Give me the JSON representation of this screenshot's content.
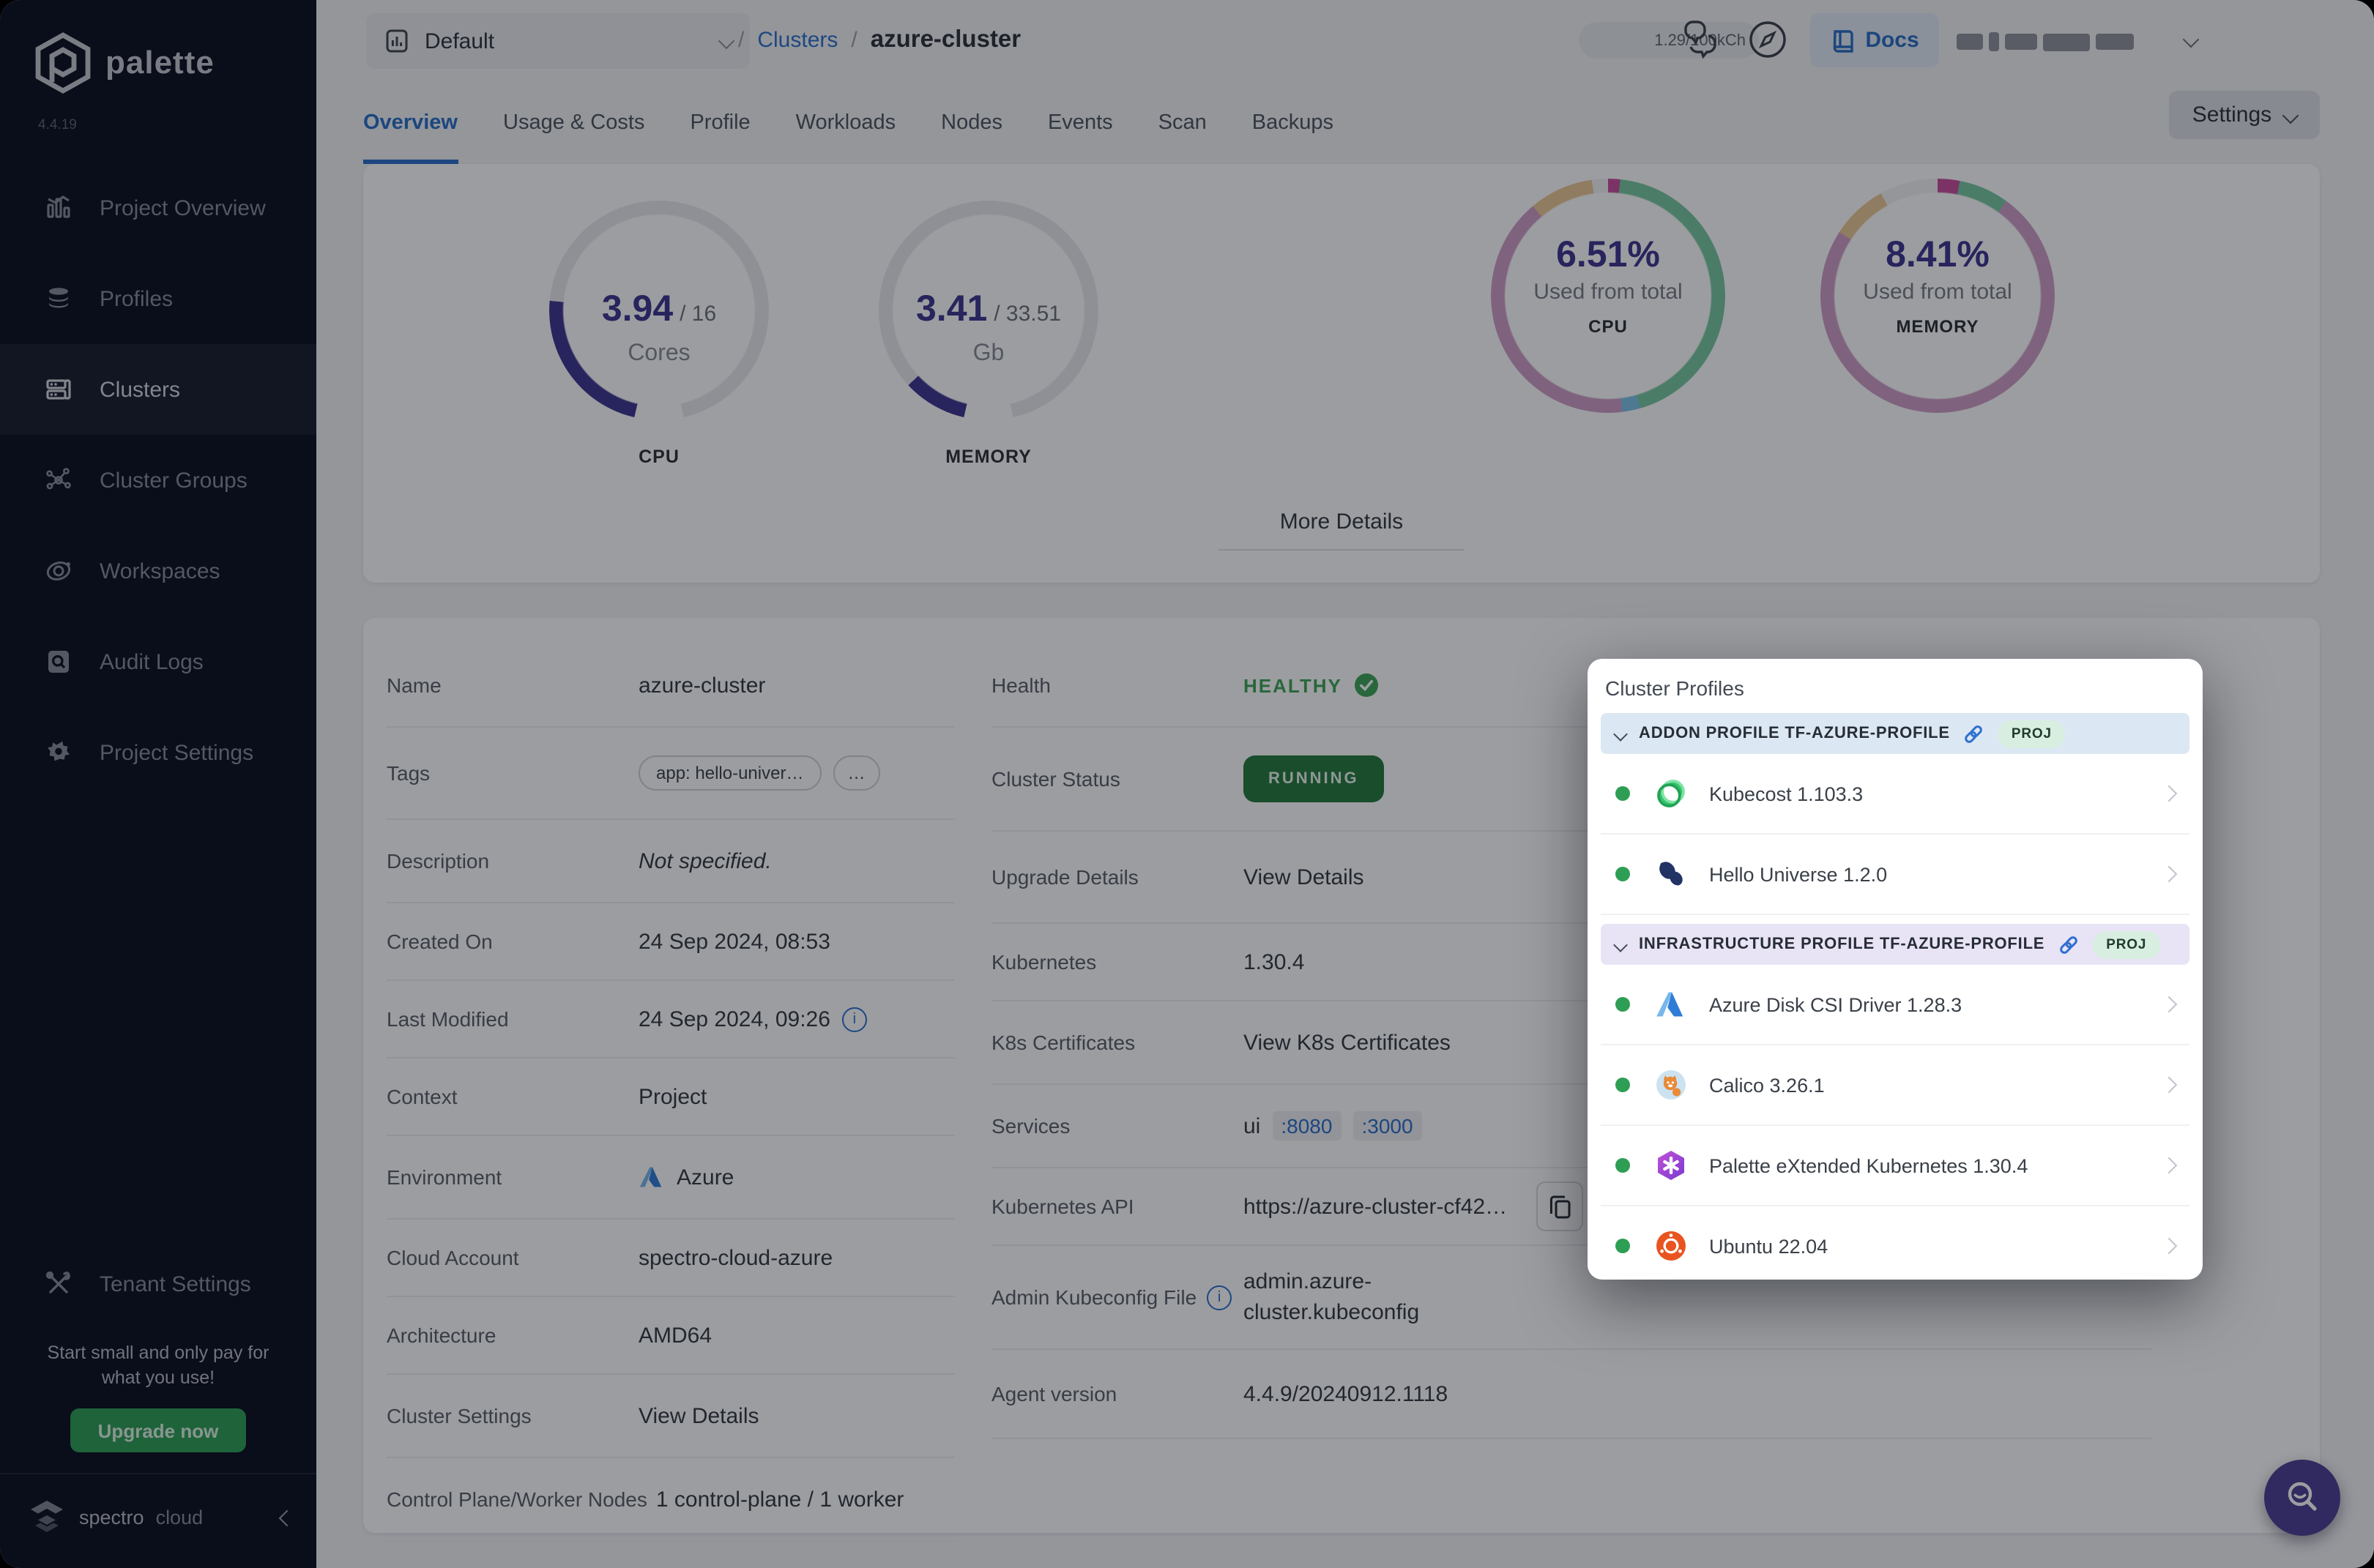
{
  "brand": {
    "name": "palette",
    "version": "4.4.19"
  },
  "sidebar": {
    "items": [
      {
        "label": "Project Overview"
      },
      {
        "label": "Profiles"
      },
      {
        "label": "Clusters"
      },
      {
        "label": "Cluster Groups"
      },
      {
        "label": "Workspaces"
      },
      {
        "label": "Audit Logs"
      },
      {
        "label": "Project Settings"
      }
    ],
    "tenant_settings": "Tenant Settings",
    "promo": "Start small and only pay for what you use!",
    "upgrade_label": "Upgrade now",
    "footer_brand": "spectro",
    "footer_brand2": "cloud"
  },
  "topbar": {
    "project_selector": "Default",
    "breadcrumb_sep": "/",
    "breadcrumb_link": "Clusters",
    "breadcrumb_current": "azure-cluster",
    "credits": "1.29/100kCh",
    "docs_label": "Docs"
  },
  "tabs": [
    {
      "label": "Overview"
    },
    {
      "label": "Usage & Costs"
    },
    {
      "label": "Profile"
    },
    {
      "label": "Workloads"
    },
    {
      "label": "Nodes"
    },
    {
      "label": "Events"
    },
    {
      "label": "Scan"
    },
    {
      "label": "Backups"
    }
  ],
  "settings_button": "Settings",
  "overview": {
    "cpu_gauge": {
      "used": "3.94",
      "total": "/ 16",
      "unit": "Cores",
      "label": "CPU",
      "fraction": 0.246
    },
    "memory_gauge": {
      "used": "3.41",
      "total": "/ 33.51",
      "unit": "Gb",
      "label": "MEMORY",
      "fraction": 0.102
    },
    "cpu_donut": {
      "percent": "6.51%",
      "caption": "Used from total",
      "label": "CPU",
      "segments": [
        {
          "name": "magenta",
          "deg": 6
        },
        {
          "name": "green",
          "deg": 158
        },
        {
          "name": "blue",
          "deg": 9
        },
        {
          "name": "pink",
          "deg": 147
        },
        {
          "name": "tan",
          "deg": 32
        },
        {
          "name": "free",
          "deg": 8
        }
      ]
    },
    "memory_donut": {
      "percent": "8.41%",
      "caption": "Used from total",
      "label": "MEMORY",
      "segments": [
        {
          "name": "magenta",
          "deg": 11
        },
        {
          "name": "green",
          "deg": 25
        },
        {
          "name": "pink",
          "deg": 267
        },
        {
          "name": "tan",
          "deg": 28
        },
        {
          "name": "free",
          "deg": 29
        }
      ]
    },
    "more_details": "More Details"
  },
  "details": {
    "name": {
      "label": "Name",
      "value": "azure-cluster"
    },
    "tags": {
      "label": "Tags",
      "tag1": "app: hello-univer…",
      "more": "…"
    },
    "description": {
      "label": "Description",
      "value": "Not specified."
    },
    "created": {
      "label": "Created On",
      "value": "24 Sep 2024, 08:53"
    },
    "modified": {
      "label": "Last Modified",
      "value": "24 Sep 2024, 09:26"
    },
    "context": {
      "label": "Context",
      "value": "Project"
    },
    "environment": {
      "label": "Environment",
      "value": "Azure"
    },
    "cloud_account": {
      "label": "Cloud Account",
      "value": "spectro-cloud-azure"
    },
    "architecture": {
      "label": "Architecture",
      "value": "AMD64"
    },
    "cluster_settings": {
      "label": "Cluster Settings",
      "value": "View Details"
    },
    "nodes": {
      "label": "Control Plane/Worker Nodes",
      "value": "1 control-plane / 1 worker"
    },
    "health": {
      "label": "Health",
      "value": "HEALTHY"
    },
    "status": {
      "label": "Cluster Status",
      "value": "RUNNING"
    },
    "upgrade": {
      "label": "Upgrade Details",
      "value": "View Details"
    },
    "kubernetes": {
      "label": "Kubernetes",
      "value": "1.30.4"
    },
    "certs": {
      "label": "K8s Certificates",
      "value": "View K8s Certificates"
    },
    "services": {
      "label": "Services",
      "prefix": "ui",
      "port1": ":8080",
      "port2": ":3000"
    },
    "api": {
      "label": "Kubernetes API",
      "value": "https://azure-cluster-cf42…"
    },
    "kubeconfig": {
      "label": "Admin Kubeconfig File",
      "value": "admin.azure-cluster.kubeconfig"
    },
    "agent": {
      "label": "Agent version",
      "value": "4.4.9/20240912.1118"
    }
  },
  "popup": {
    "title": "Cluster Profiles",
    "addon_section": {
      "title": "ADDON PROFILE TF-AZURE-PROFILE",
      "badge": "PROJ"
    },
    "infra_section": {
      "title": "INFRASTRUCTURE PROFILE TF-AZURE-PROFILE",
      "badge": "PROJ"
    },
    "addon_items": [
      {
        "name": "Kubecost 1.103.3"
      },
      {
        "name": "Hello Universe 1.2.0"
      }
    ],
    "infra_items": [
      {
        "name": "Azure Disk CSI Driver 1.28.3"
      },
      {
        "name": "Calico 3.26.1"
      },
      {
        "name": "Palette eXtended Kubernetes 1.30.4"
      },
      {
        "name": "Ubuntu 22.04"
      }
    ]
  },
  "colors": {
    "accent_blue": "#2a6fc9",
    "indigo": "#3f3690",
    "status_green": "#2e9e55",
    "running_pill": "#257a3c",
    "donut_green": "#79c9a2",
    "donut_pink": "#cf9fc6",
    "donut_tan": "#ecc894",
    "donut_blue": "#7fc4e8",
    "donut_magenta": "#c94f9e",
    "sidebar_bg": "#0c0f21"
  }
}
